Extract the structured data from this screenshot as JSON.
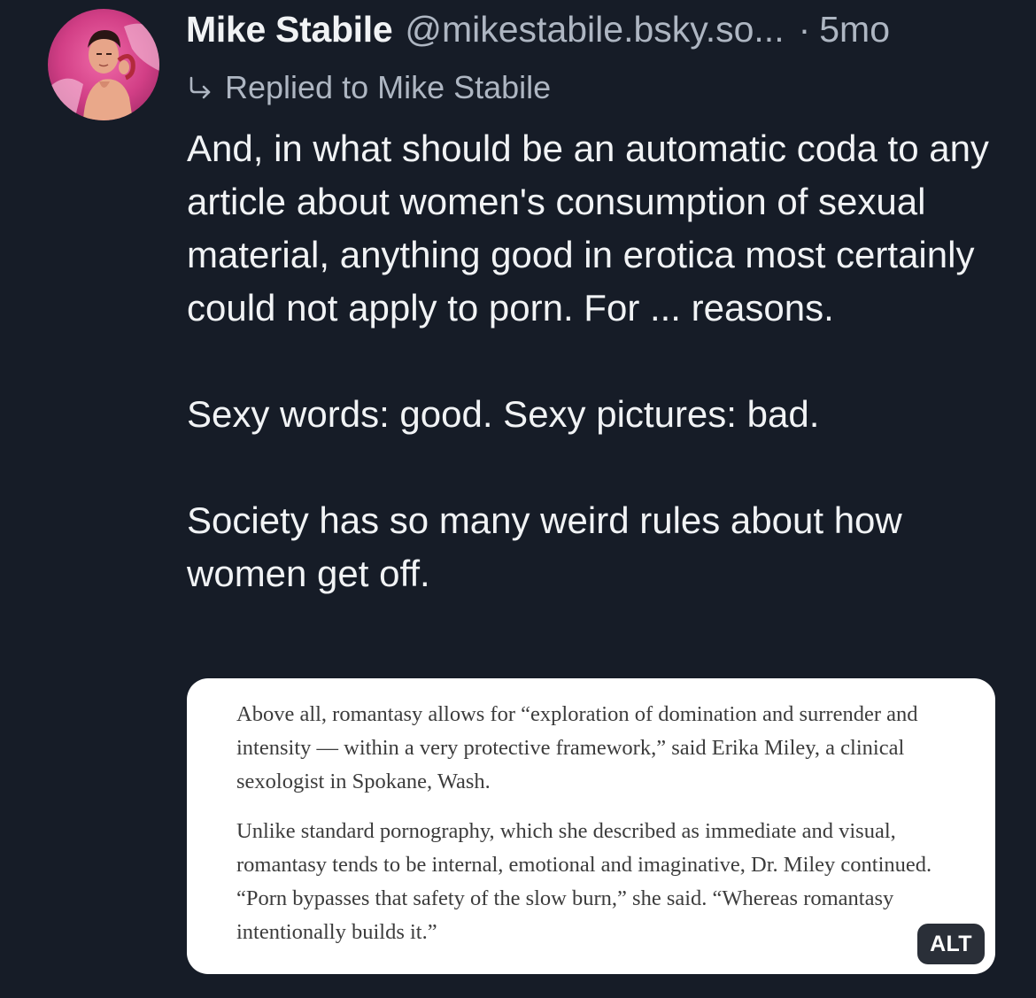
{
  "post": {
    "author": {
      "display_name": "Mike Stabile",
      "handle": "@mikestabile.bsky.so...",
      "avatar": "avatar-photo"
    },
    "separator": "·",
    "age": "5mo",
    "reply_context": {
      "icon": "reply-arrow-icon",
      "text": "Replied to Mike Stabile"
    },
    "paragraphs": [
      "And, in what should be an automatic coda to any article about women's consumption of sexual material, anything good in erotica most certainly could not apply to porn. For ... reasons.",
      "Sexy words: good. Sexy pictures: bad.",
      "Society has so many weird rules about how women get off."
    ],
    "embed_image": {
      "paragraphs": [
        "Above all, romantasy allows for “exploration of domination and surrender and intensity — within a very protective framework,” said Erika Miley, a clinical sexologist in Spokane, Wash.",
        "Unlike standard pornography, which she described as immediate and visual, romantasy tends to be internal, emotional and imaginative, Dr. Miley continued. “Porn bypasses that safety of the slow burn,” she said. “Whereas romantasy intentionally builds it.”"
      ],
      "alt_badge": "ALT"
    }
  },
  "colors": {
    "background": "#161c27",
    "text_primary": "#f1f3f5",
    "text_secondary": "#aeb6c2",
    "embed_background": "#ffffff",
    "alt_badge_background": "#2a2f38"
  }
}
